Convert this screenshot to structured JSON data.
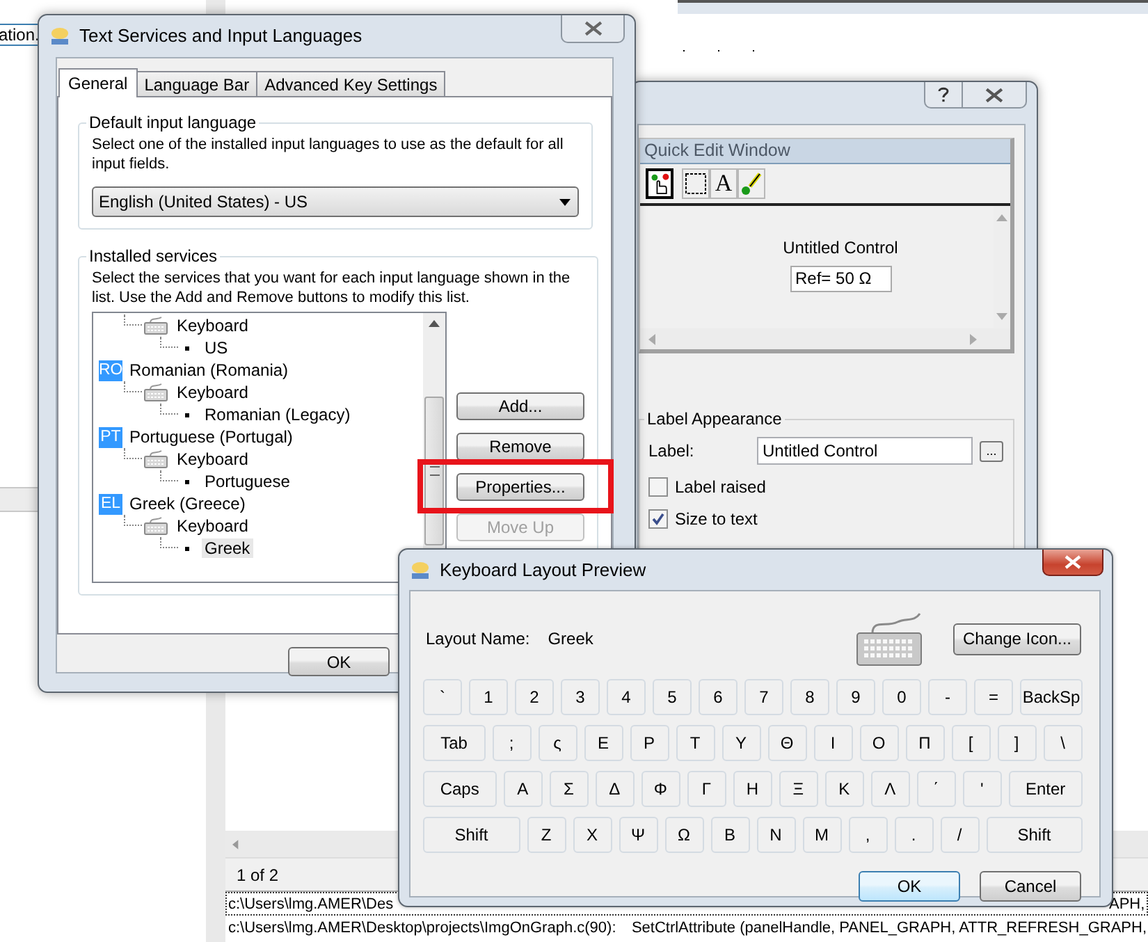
{
  "background": {
    "file_field": "ation.",
    "page_counter": "1 of 2",
    "output_lines": [
      {
        "path": "c:\\Users\\lmg.AMER\\Des",
        "code": "APH,",
        "selected": true
      },
      {
        "path": "c:\\Users\\lmg.AMER\\Desktop\\projects\\ImgOnGraph.c(90):",
        "code": "SetCtrlAttribute (panelHandle, PANEL_GRAPH, ATTR_REFRESH_GRAPH,",
        "selected": false
      }
    ]
  },
  "text_services": {
    "title": "Text Services and Input Languages",
    "tabs": [
      {
        "label": "General",
        "selected": true
      },
      {
        "label": "Language Bar",
        "selected": false
      },
      {
        "label": "Advanced Key Settings",
        "selected": false
      }
    ],
    "default_group": {
      "title": "Default input language",
      "description": "Select one of the installed input languages to use as the default for all input fields.",
      "dropdown": "English (United States) - US"
    },
    "services_group": {
      "title": "Installed services",
      "description": "Select the services that you want for each input language shown in the list. Use the Add and Remove buttons to modify this list.",
      "tree": [
        {
          "kind": "service",
          "label": "Keyboard",
          "selected": false,
          "children": [
            {
              "kind": "layout",
              "label": "US",
              "selected": false
            }
          ]
        },
        {
          "kind": "language",
          "badge": "RO",
          "label": "Romanian (Romania)",
          "selected": false,
          "children": [
            {
              "kind": "service",
              "label": "Keyboard",
              "selected": false,
              "children": [
                {
                  "kind": "layout",
                  "label": "Romanian (Legacy)",
                  "selected": false
                }
              ]
            }
          ]
        },
        {
          "kind": "language",
          "badge": "PT",
          "label": "Portuguese (Portugal)",
          "selected": false,
          "children": [
            {
              "kind": "service",
              "label": "Keyboard",
              "selected": false,
              "children": [
                {
                  "kind": "layout",
                  "label": "Portuguese",
                  "selected": false
                }
              ]
            }
          ]
        },
        {
          "kind": "language",
          "badge": "EL",
          "label": "Greek (Greece)",
          "selected": false,
          "children": [
            {
              "kind": "service",
              "label": "Keyboard",
              "selected": false,
              "children": [
                {
                  "kind": "layout",
                  "label": "Greek",
                  "selected": true
                }
              ]
            }
          ]
        }
      ],
      "buttons": [
        {
          "label": "Add...",
          "disabled": false,
          "highlighted": false
        },
        {
          "label": "Remove",
          "disabled": false,
          "highlighted": false
        },
        {
          "label": "Properties...",
          "disabled": false,
          "highlighted": true
        },
        {
          "label": "Move Up",
          "disabled": true,
          "highlighted": false
        }
      ]
    },
    "footer_buttons": [
      "OK"
    ]
  },
  "quick_edit": {
    "panel_title": "Quick Edit Window",
    "tools": [
      {
        "kind": "pointer",
        "selected": true
      },
      {
        "kind": "select",
        "selected": false
      },
      {
        "kind": "text",
        "glyph": "A",
        "selected": false
      },
      {
        "kind": "color",
        "selected": false
      }
    ],
    "control_label": "Untitled Control",
    "control_value": "Ref= 50 Ω",
    "label_appearance": {
      "title": "Label Appearance",
      "label_caption": "Label:",
      "label_value": "Untitled Control",
      "browse_button": "...",
      "checkboxes": [
        {
          "label": "Label raised",
          "checked": false
        },
        {
          "label": "Size to text",
          "checked": true
        }
      ]
    }
  },
  "keyboard_preview": {
    "title": "Keyboard Layout Preview",
    "layout_caption": "Layout Name:",
    "layout_name": "Greek",
    "change_icon_button": "Change Icon...",
    "rows": [
      {
        "keys": [
          {
            "label": "`",
            "kind": "key"
          },
          {
            "label": "1",
            "kind": "key"
          },
          {
            "label": "2",
            "kind": "key"
          },
          {
            "label": "3",
            "kind": "key"
          },
          {
            "label": "4",
            "kind": "key"
          },
          {
            "label": "5",
            "kind": "key"
          },
          {
            "label": "6",
            "kind": "key"
          },
          {
            "label": "7",
            "kind": "key"
          },
          {
            "label": "8",
            "kind": "key"
          },
          {
            "label": "9",
            "kind": "key"
          },
          {
            "label": "0",
            "kind": "key"
          },
          {
            "label": "-",
            "kind": "key"
          },
          {
            "label": "=",
            "kind": "key"
          },
          {
            "label": "BackSp",
            "kind": "wide"
          }
        ]
      },
      {
        "keys": [
          {
            "label": "Tab",
            "kind": "wide"
          },
          {
            "label": ";",
            "kind": "key"
          },
          {
            "label": "ς",
            "kind": "key"
          },
          {
            "label": "Ε",
            "kind": "key"
          },
          {
            "label": "Ρ",
            "kind": "key"
          },
          {
            "label": "Τ",
            "kind": "key"
          },
          {
            "label": "Υ",
            "kind": "key"
          },
          {
            "label": "Θ",
            "kind": "key"
          },
          {
            "label": "Ι",
            "kind": "key"
          },
          {
            "label": "Ο",
            "kind": "key"
          },
          {
            "label": "Π",
            "kind": "key"
          },
          {
            "label": "[",
            "kind": "key"
          },
          {
            "label": "]",
            "kind": "key"
          },
          {
            "label": "\\",
            "kind": "wide"
          }
        ]
      },
      {
        "keys": [
          {
            "label": "Caps",
            "kind": "wide"
          },
          {
            "label": "Α",
            "kind": "key"
          },
          {
            "label": "Σ",
            "kind": "key"
          },
          {
            "label": "Δ",
            "kind": "key"
          },
          {
            "label": "Φ",
            "kind": "key"
          },
          {
            "label": "Γ",
            "kind": "key"
          },
          {
            "label": "Η",
            "kind": "key"
          },
          {
            "label": "Ξ",
            "kind": "key"
          },
          {
            "label": "Κ",
            "kind": "key"
          },
          {
            "label": "Λ",
            "kind": "key"
          },
          {
            "label": "΄",
            "kind": "key"
          },
          {
            "label": "'",
            "kind": "key"
          },
          {
            "label": "Enter",
            "kind": "wide"
          }
        ]
      },
      {
        "keys": [
          {
            "label": "Shift",
            "kind": "wide"
          },
          {
            "label": "Ζ",
            "kind": "key"
          },
          {
            "label": "Χ",
            "kind": "key"
          },
          {
            "label": "Ψ",
            "kind": "key"
          },
          {
            "label": "Ω",
            "kind": "key"
          },
          {
            "label": "Β",
            "kind": "key"
          },
          {
            "label": "Ν",
            "kind": "key"
          },
          {
            "label": "Μ",
            "kind": "key"
          },
          {
            "label": ",",
            "kind": "key"
          },
          {
            "label": ".",
            "kind": "key"
          },
          {
            "label": "/",
            "kind": "key"
          },
          {
            "label": "Shift",
            "kind": "wide"
          }
        ]
      }
    ],
    "buttons": [
      {
        "label": "OK",
        "default": true
      },
      {
        "label": "Cancel",
        "default": false
      }
    ]
  }
}
